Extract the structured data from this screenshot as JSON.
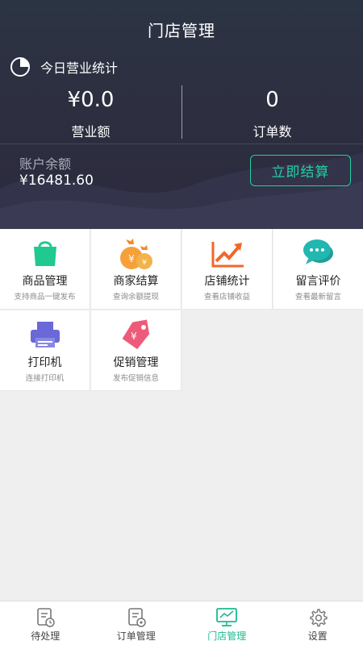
{
  "header": {
    "title": "门店管理",
    "today_stats_label": "今日营业统计",
    "revenue_value": "¥0.0",
    "revenue_label": "营业额",
    "orders_value": "0",
    "orders_label": "订单数",
    "balance_label": "账户余额",
    "balance_value": "¥16481.60",
    "settle_button": "立即结算",
    "accent_color": "#1fd1a0"
  },
  "grid": {
    "items": [
      {
        "title": "商品管理",
        "subtitle": "支持商品一键发布",
        "icon": "shopping-bag-icon",
        "color": "#20c98f"
      },
      {
        "title": "商家结算",
        "subtitle": "查询余额提现",
        "icon": "money-bag-icon",
        "color": "#f6a03a"
      },
      {
        "title": "店铺统计",
        "subtitle": "查看店铺收益",
        "icon": "trend-chart-icon",
        "color": "#f2662a"
      },
      {
        "title": "留言评价",
        "subtitle": "查看最新留言",
        "icon": "chat-bubbles-icon",
        "color": "#22b7b1"
      },
      {
        "title": "打印机",
        "subtitle": "连接打印机",
        "icon": "printer-icon",
        "color": "#6b68d8"
      },
      {
        "title": "促销管理",
        "subtitle": "发布促销信息",
        "icon": "price-tag-icon",
        "color": "#ee5b7a"
      }
    ]
  },
  "tabbar": {
    "tabs": [
      {
        "label": "待处理",
        "icon": "pending-doc-icon"
      },
      {
        "label": "订单管理",
        "icon": "order-doc-icon"
      },
      {
        "label": "门店管理",
        "icon": "store-monitor-icon",
        "active": true
      },
      {
        "label": "设置",
        "icon": "gear-icon"
      }
    ],
    "active_color": "#1cb98f"
  }
}
